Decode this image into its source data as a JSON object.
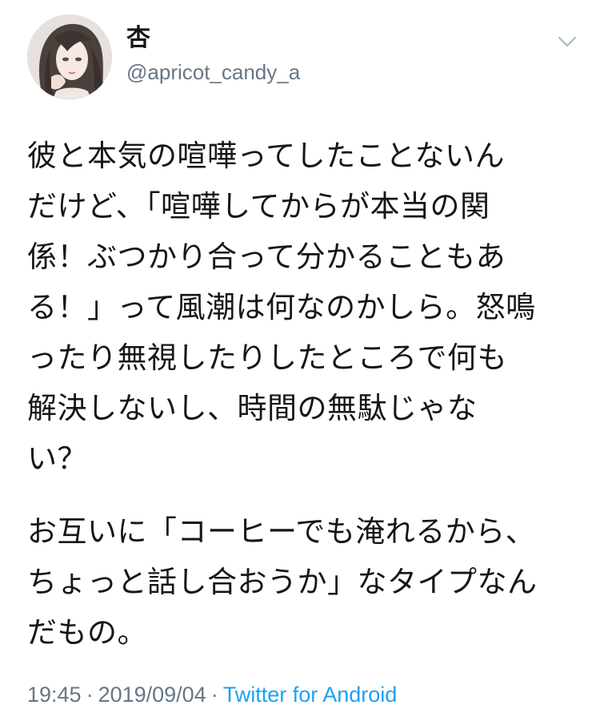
{
  "tweet": {
    "display_name": "杏",
    "handle": "@apricot_candy_a",
    "menu_icon": "chevron-down-icon",
    "avatar_icon": "avatar",
    "body": {
      "lines_1": [
        "彼と本気の喧嘩ってしたことないん",
        "だけど、「喧嘩してからが本当の関",
        "係！ぶつかり合って分かることもあ",
        "る！」って風潮は何なのかしら。怒鳴",
        "ったり無視したりしたところで何も",
        "解決しないし、時間の無駄じゃな",
        "い？"
      ],
      "lines_2": [
        "お互いに「コーヒーでも淹れるから、",
        "ちょっと話し合おうか」なタイプなん",
        "だもの。"
      ]
    },
    "time": "19:45",
    "separator": "·",
    "date": "2019/09/04",
    "source": "Twitter for Android"
  },
  "colors": {
    "text": "#14171a",
    "secondary": "#657786",
    "link": "#1da1f2",
    "background": "#ffffff"
  }
}
